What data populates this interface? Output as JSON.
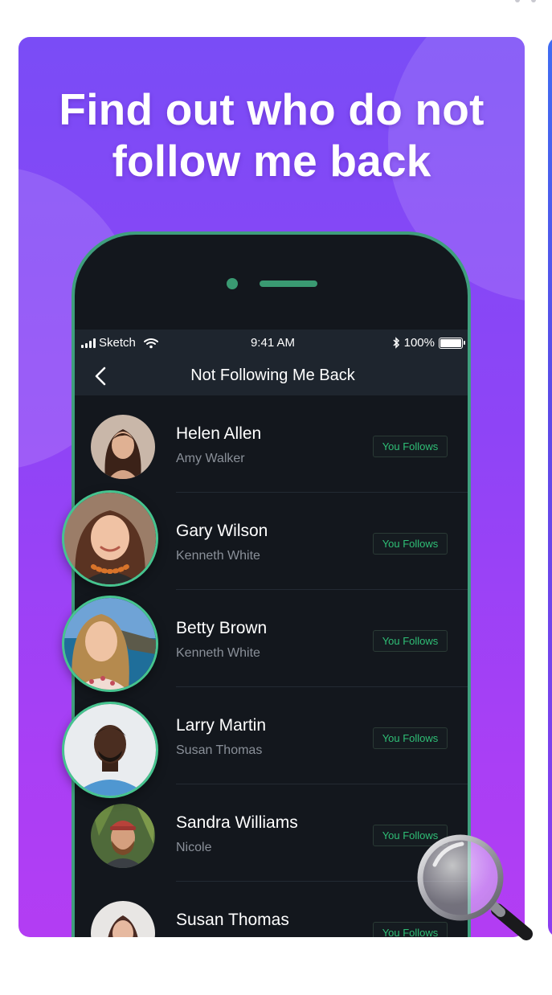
{
  "headline": {
    "line1": "Find out who do not",
    "line2": "follow me back"
  },
  "status_bar": {
    "carrier": "Sketch",
    "time": "9:41 AM",
    "battery": "100%"
  },
  "nav": {
    "title": "Not Following Me Back"
  },
  "users": [
    {
      "name": "Helen Allen",
      "subtitle": "Amy Walker",
      "button": "You Follows"
    },
    {
      "name": "Gary Wilson",
      "subtitle": "Kenneth White",
      "button": "You Follows"
    },
    {
      "name": "Betty Brown",
      "subtitle": "Kenneth White",
      "button": "You Follows"
    },
    {
      "name": "Larry Martin",
      "subtitle": "Susan Thomas",
      "button": "You Follows"
    },
    {
      "name": "Sandra Williams",
      "subtitle": "Nicole",
      "button": "You Follows"
    },
    {
      "name": "Susan Thomas",
      "subtitle": "",
      "button": "You Follows"
    }
  ],
  "colors": {
    "card_gradient_top": "#7a4cf6",
    "card_gradient_bottom": "#b33df3",
    "phone_border": "#3f9e7d",
    "follow_text": "#2fbf76",
    "screen_bg": "#13171d"
  }
}
